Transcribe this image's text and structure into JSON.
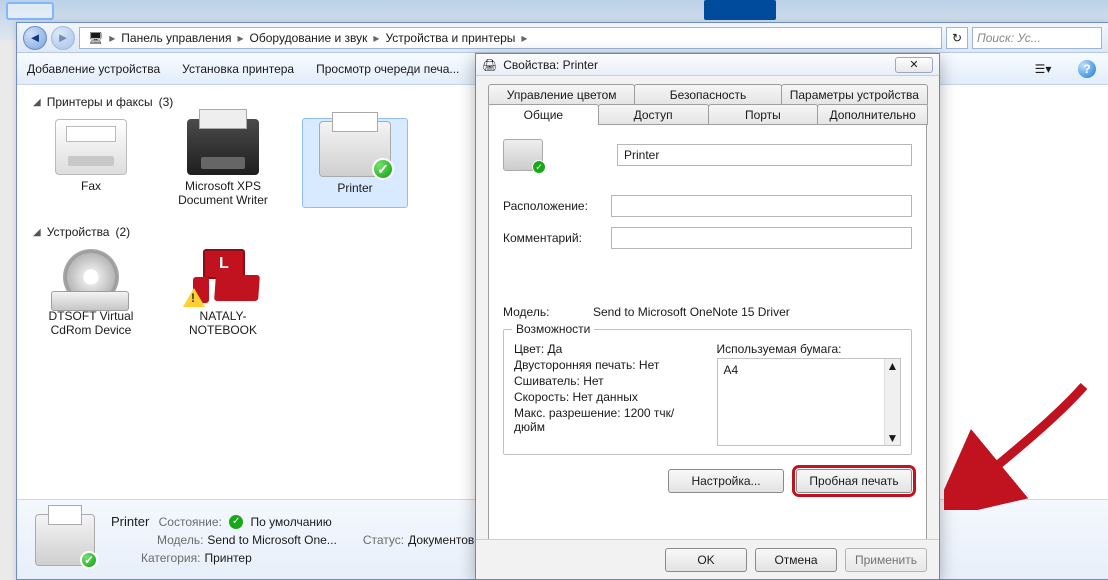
{
  "breadcrumbs": [
    "Панель управления",
    "Оборудование и звук",
    "Устройства и принтеры"
  ],
  "search_placeholder": "Поиск: Ус...",
  "toolbar": {
    "add_device": "Добавление устройства",
    "add_printer": "Установка принтера",
    "view_queue": "Просмотр очереди печа..."
  },
  "categories": {
    "printers": {
      "label": "Принтеры и факсы",
      "count": "(3)"
    },
    "devices": {
      "label": "Устройства",
      "count": "(2)"
    }
  },
  "items": {
    "fax": "Fax",
    "xps": "Microsoft XPS Document Writer",
    "printer": "Printer",
    "dtsoft": "DTSOFT Virtual CdRom Device",
    "notebook": "NATALY-NOTEBOOK"
  },
  "details": {
    "title": "Printer",
    "state_k": "Состояние:",
    "state_v": "По умолчанию",
    "model_k": "Модель:",
    "model_v": "Send to Microsoft One...",
    "cat_k": "Категория:",
    "cat_v": "Принтер",
    "status_k": "Статус:",
    "status_v": "Документов..."
  },
  "dialog": {
    "title": "Свойства: Printer",
    "tabs_top": [
      "Управление цветом",
      "Безопасность",
      "Параметры устройства"
    ],
    "tabs_bot": [
      "Общие",
      "Доступ",
      "Порты",
      "Дополнительно"
    ],
    "name_value": "Printer",
    "location_k": "Расположение:",
    "comment_k": "Комментарий:",
    "model_k": "Модель:",
    "model_v": "Send to Microsoft OneNote 15 Driver",
    "features_legend": "Возможности",
    "features": {
      "color": "Цвет: Да",
      "duplex": "Двусторонняя печать: Нет",
      "stapler": "Сшиватель: Нет",
      "speed": "Скорость: Нет данных",
      "maxres": "Макс. разрешение: 1200 тчк/дюйм",
      "paper_label": "Используемая бумага:",
      "paper_value": "A4"
    },
    "btn_settings": "Настройка...",
    "btn_testprint": "Пробная печать",
    "ok": "OK",
    "cancel": "Отмена",
    "apply": "Применить"
  }
}
